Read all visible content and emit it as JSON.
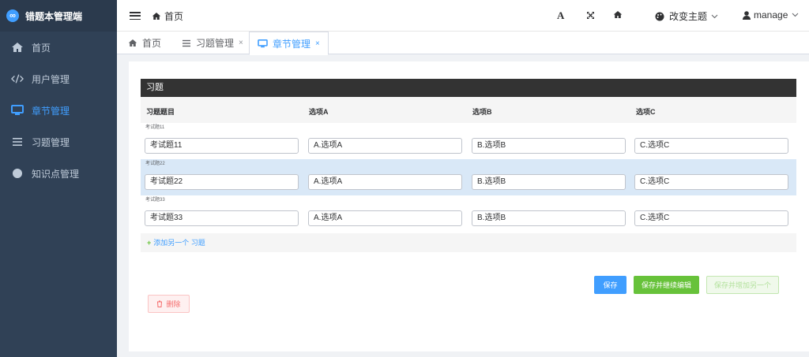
{
  "app": {
    "title": "错题本管理端",
    "logo_glyph": "∞"
  },
  "sidebar": {
    "items": [
      {
        "label": "首页",
        "icon": "home-icon"
      },
      {
        "label": "用户管理",
        "icon": "code-icon"
      },
      {
        "label": "章节管理",
        "icon": "monitor-icon",
        "active": true
      },
      {
        "label": "习题管理",
        "icon": "list-icon"
      },
      {
        "label": "知识点管理",
        "icon": "circle-icon"
      }
    ]
  },
  "navbar": {
    "breadcrumb": "首页",
    "theme_label": "改变主题",
    "user_label": "manage",
    "font_icon_glyph": "A"
  },
  "tags": [
    {
      "label": "首页"
    },
    {
      "label": "习题管理",
      "close": "×"
    },
    {
      "label": "章节管理",
      "close": "×",
      "active": true
    }
  ],
  "form": {
    "section_title": "习题",
    "columns": [
      "习题题目",
      "选项A",
      "选项B",
      "选项C"
    ],
    "rows": [
      {
        "label": "考试题11",
        "values": [
          "考试题11",
          "A.选项A",
          "B.选项B",
          "C.选项C"
        ]
      },
      {
        "label": "考试题22",
        "values": [
          "考试题22",
          "A.选项A",
          "B.选项B",
          "C.选项C"
        ],
        "highlight": true
      },
      {
        "label": "考试题33",
        "values": [
          "考试题33",
          "A.选项A",
          "B.选项B",
          "C.选项C"
        ]
      }
    ],
    "add_row_plus": "+",
    "add_row_label": "添加另一个 习题"
  },
  "actions": {
    "save": "保存",
    "save_continue": "保存并继续编辑",
    "save_add": "保存并增加另一个",
    "delete": "删除"
  },
  "colors": {
    "sidebar_bg": "#304156",
    "active": "#409eff",
    "success": "#67c23a",
    "danger": "#f56c6c"
  }
}
